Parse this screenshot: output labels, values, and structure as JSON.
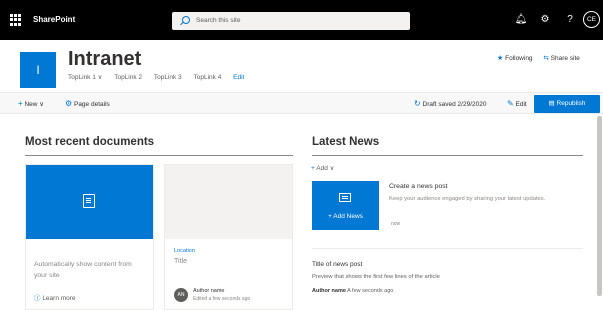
{
  "suite_bar": {
    "brand": "SharePoint",
    "search_placeholder": "Search this site",
    "icons": [
      "notification-bell-icon",
      "gear-icon",
      "help-icon"
    ],
    "avatar_initials": "CE"
  },
  "site_header": {
    "logo_letter": "I",
    "title": "Intranet",
    "nav": [
      {
        "label": "TopLink 1 ∨"
      },
      {
        "label": "TopLink 2"
      },
      {
        "label": "TopLink 3"
      },
      {
        "label": "TopLink 4"
      }
    ],
    "nav_edit": "Edit",
    "following_label": "Following",
    "share_label": "Share site"
  },
  "command_bar": {
    "new_label": "New ∨",
    "page_details_label": "Page details",
    "draft_status": "Draft saved 2/29/2020",
    "edit_label": "Edit",
    "republish_label": "Republish"
  },
  "documents": {
    "section_title": "Most recent documents",
    "card1": {
      "description": "Automatically show content from your site",
      "learn_more": "Learn more"
    },
    "card2": {
      "location": "Location",
      "title": "Title",
      "avatar_initials": "AN",
      "author_name": "Author name",
      "edited": "Edited a few seconds ago"
    }
  },
  "news": {
    "section_title": "Latest News",
    "add_label": "Add ∨",
    "tile_label": "+ Add News",
    "create_title": "Create a news post",
    "create_description": "Keep your audience engaged by sharing your latest updates.",
    "create_time": "now",
    "item_title": "Title of news post",
    "item_preview": "Preview that shows the first few lines of the article",
    "item_author": "Author name",
    "item_time": "A few seconds ago"
  },
  "colors": {
    "accent": "#0078d4",
    "suite_bar": "#000000"
  }
}
